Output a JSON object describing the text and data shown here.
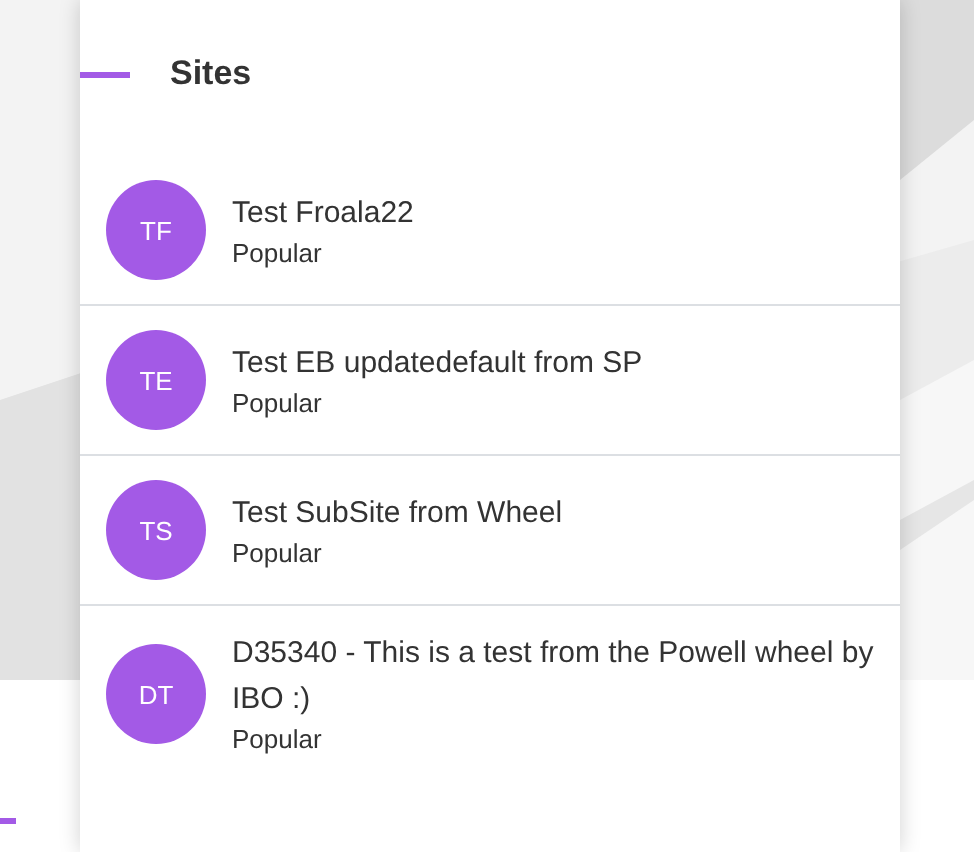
{
  "panel": {
    "title": "Sites",
    "sites": [
      {
        "initials": "TF",
        "name": "Test Froala22",
        "category": "Popular",
        "color": "#a35ae6"
      },
      {
        "initials": "TE",
        "name": "Test EB updatedefault from SP",
        "category": "Popular",
        "color": "#a35ae6"
      },
      {
        "initials": "TS",
        "name": "Test SubSite from Wheel",
        "category": "Popular",
        "color": "#a35ae6"
      },
      {
        "initials": "DT",
        "name": "D35340 - This is a test from the Powell wheel by IBO :)",
        "category": "Popular",
        "color": "#a35ae6"
      }
    ]
  }
}
